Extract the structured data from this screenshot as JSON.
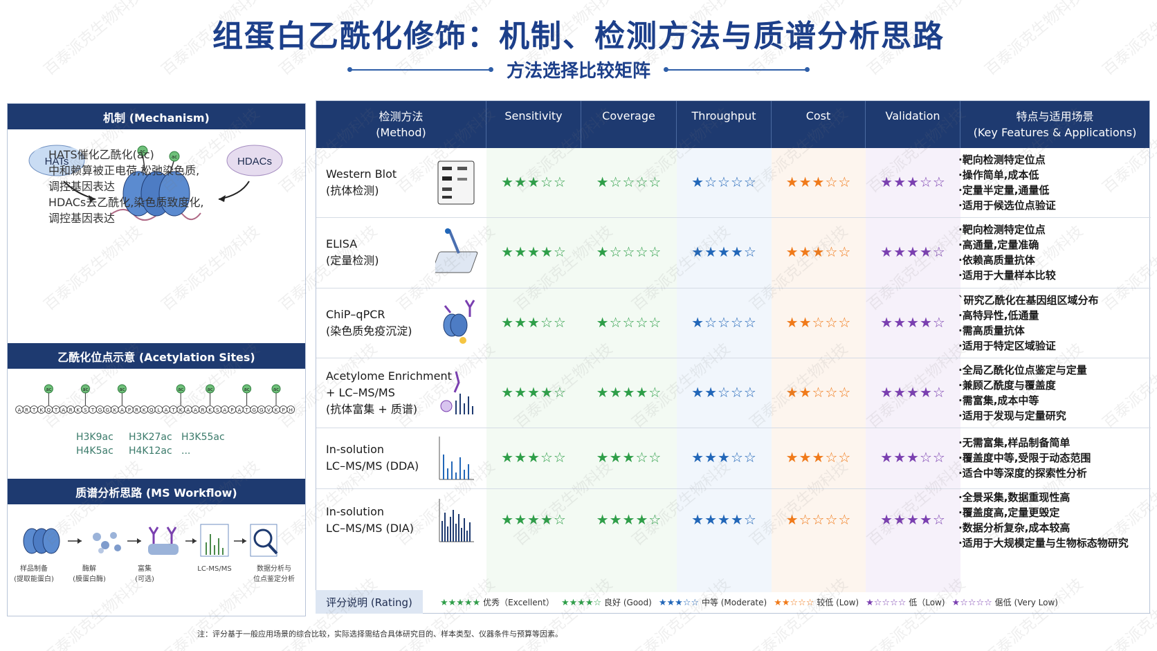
{
  "title": "组蛋白乙酰化修饰：机制、检测方法与质谱分析思路",
  "subtitle": "方法选择比较矩阵",
  "mechanism": {
    "header": "机制 (Mechanism)",
    "hats_label": "HATs",
    "hdacs_label": "HDACs",
    "ac_label": "ac",
    "text_lines": [
      "HATS催化乙酰化(ac)",
      "中和赖算被正电荷,松弛染色质,",
      "调控基因表达",
      "HDACs去乙酰化,染色质致度化,",
      "调控基因表达"
    ]
  },
  "acetylation_sites": {
    "header": "乙酰化位点示意 (Acetylation Sites)",
    "sequence": "ARTKQTARKSTGGKAPRKQLATKAARKSAPATGGVKPH",
    "site_names_row1": [
      "H3K9ac",
      "H3K27ac",
      "H3K55ac"
    ],
    "site_names_row2": [
      "H4K5ac",
      "H4K12ac",
      "..."
    ]
  },
  "ms_workflow": {
    "header": "质谱分析思路 (MS Workflow)",
    "steps": [
      {
        "line1": "样品制备",
        "line2": "(提取能蛋白)"
      },
      {
        "line1": "酶解",
        "line2": "(膜蛋白酶)"
      },
      {
        "line1": "富集",
        "line2": "(可选)"
      },
      {
        "line1": "LC-MS/MS",
        "line2": ""
      },
      {
        "line1": "数据分析与",
        "line2": "位点鉴定分析"
      }
    ]
  },
  "table": {
    "headers": {
      "method_line1": "检测方法",
      "method_line2": "(Method)",
      "sensitivity": "Sensitivity",
      "coverage": "Coverage",
      "throughput": "Throughput",
      "cost": "Cost",
      "validation": "Validation",
      "features_line1": "特点与适用场景",
      "features_line2": "(Key Features & Applications)"
    },
    "colors": {
      "sensitivity": "#2e9e48",
      "coverage": "#2e9e48",
      "throughput": "#2166b8",
      "cost": "#f07a1a",
      "validation": "#7a3fb0"
    },
    "rows": [
      {
        "name_line1": "Western Blot",
        "name_line2": "(抗体检测)",
        "name_line3": "",
        "icon": "western-blot-gel-icon",
        "sensitivity": 3,
        "coverage": 1,
        "throughput": 1,
        "cost": 3,
        "validation": 3,
        "features": [
          "·靶向检测特定位点",
          "·操作简单,成本低",
          "·定量半定量,通量低",
          "·适用于候选位点验证"
        ]
      },
      {
        "name_line1": "ELISA",
        "name_line2": "(定量检测)",
        "name_line3": "",
        "icon": "elisa-plate-pipette-icon",
        "sensitivity": 4,
        "coverage": 1,
        "throughput": 4,
        "cost": 3,
        "validation": 4,
        "features": [
          "·靶向检测特定位点",
          "·高通量,定量准确",
          "·依赖高质量抗体",
          "·适用于大量样本比较"
        ]
      },
      {
        "name_line1": "ChiP–qPCR",
        "name_line2": "(染色质免疫沉淀)",
        "name_line3": "",
        "icon": "chip-nucleosome-antibody-icon",
        "sensitivity": 3,
        "coverage": 1,
        "throughput": 1,
        "cost": 2,
        "validation": 4,
        "features": [
          "`研究乙酰化在基因组区域分布",
          "·高特异性,低通量",
          "·需高质量抗体",
          "·适用于特定区域验证"
        ]
      },
      {
        "name_line1": "Acetylome Enrichment",
        "name_line2": "+ LC–MS/MS",
        "name_line3": "(抗体富集 + 质谱)",
        "icon": "enrichment-spectrum-icon",
        "sensitivity": 4,
        "coverage": 4,
        "throughput": 2,
        "cost": 2,
        "validation": 4,
        "features": [
          "·全局乙酰化位点鉴定与定量",
          "·兼顾乙酰度与覆盖度",
          "·需富集,成本中等",
          "·适用于发现与定量研究"
        ]
      },
      {
        "name_line1": "In-solution",
        "name_line2": "LC–MS/MS (DDA)",
        "name_line3": "",
        "icon": "dda-spectrum-icon",
        "sensitivity": 3,
        "coverage": 3,
        "throughput": 3,
        "cost": 3,
        "validation": 3,
        "features": [
          "·无需富集,样品制备简单",
          "·覆盖度中等,受限于动态范围",
          "·适合中等深度的探索性分析"
        ]
      },
      {
        "name_line1": "In-solution",
        "name_line2": "LC–MS/MS (DIA)",
        "name_line3": "",
        "icon": "dia-spectrum-icon",
        "sensitivity": 4,
        "coverage": 4,
        "throughput": 4,
        "cost": 1,
        "validation": 4,
        "features": [
          "·全景采集,数据重现性高",
          "·覆盖度高,定量更毁定",
          "·数据分析复杂,成本较高",
          "·适用于大规模定量与生物标态物研究"
        ]
      }
    ]
  },
  "legend": {
    "label": "评分说明 (Rating)",
    "items": [
      {
        "stars": 5,
        "color": "#2e9e48",
        "text": "优秀（Excellent）"
      },
      {
        "stars": 4,
        "color": "#2e9e48",
        "text": "良好 (Good)"
      },
      {
        "stars": 3,
        "color": "#2166b8",
        "text": "中等 (Moderate)"
      },
      {
        "stars": 2,
        "color": "#f07a1a",
        "text": "较低 (Low)"
      },
      {
        "stars": 1,
        "color": "#7a3fb0",
        "text": "低（Low)"
      },
      {
        "stars": 1,
        "color": "#7a3fb0",
        "text": "倨低 (Very Low)"
      }
    ]
  },
  "note": "注：评分基于一般应用场景的综合比较，实际选择需结合具体研究目的、样本类型、仪器条件与预算等因素。",
  "watermark": "百泰派克生物科技"
}
